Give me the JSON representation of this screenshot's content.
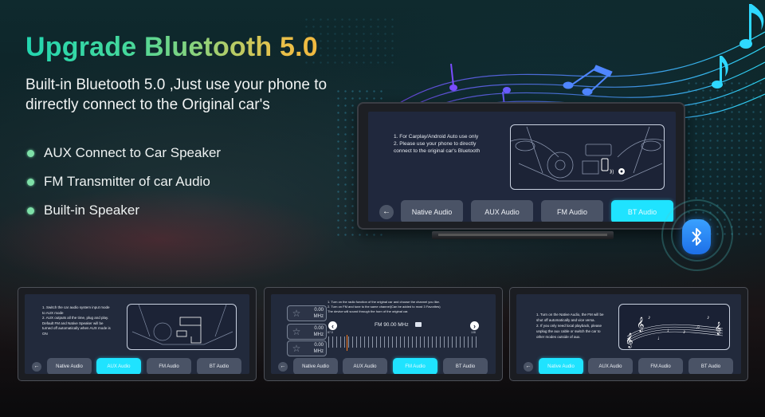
{
  "headline": "Upgrade Bluetooth 5.0",
  "subtitle": "Built-in Bluetooth 5.0 ,Just use your phone to dirrectly connect to the Original car's",
  "features": [
    "AUX Connect to Car Speaker",
    "FM Transmitter of car Audio",
    "Built-in Speaker"
  ],
  "colors": {
    "active_button": "#1fe3ff",
    "inactive_button": "#4a5366",
    "bullet": "#7ee0a8",
    "bluetooth_badge": "#2a86f5"
  },
  "main_device": {
    "instructions": [
      "1. For Carplay/Android Auto use only",
      "2. Please use your phone to directly",
      "connect to the original car's Bluetooth"
    ],
    "illustration": "car-interior-bluetooth",
    "back_icon": "←",
    "buttons": [
      "Native Audio",
      "AUX Audio",
      "FM Audio",
      "BT Audio"
    ],
    "active_button": "BT Audio"
  },
  "aux_device": {
    "instructions": [
      "1. Switch the car audio system input mode",
      "to AUX mode",
      "2. AUX outputs all the time, plug and play.",
      "Default FM and Native Speaker will be",
      "turned off automatically when AUX mode is",
      "ON"
    ],
    "illustration": "car-interior-aux-cable",
    "back_icon": "←",
    "buttons": [
      "Native Audio",
      "AUX Audio",
      "FM Audio",
      "BT Audio"
    ],
    "active_button": "AUX Audio"
  },
  "fm_device": {
    "instructions": [
      "1. Turn on the radio function of the original car and choose the channel you like.",
      "2. Turn on FM and tune to the same channel(Can be added to most 3 Favorites)",
      "The device will sound through the horn of the original car."
    ],
    "favorites": [
      {
        "value": "0.00",
        "unit": "MHz"
      },
      {
        "value": "0.00",
        "unit": "MHz"
      },
      {
        "value": "0.00",
        "unit": "MHz"
      }
    ],
    "frequency_label": "FM 90.00 MHz",
    "frequency_mhz": 90.0,
    "range_min": "87.5",
    "range_max": "108",
    "prev_icon": "‹",
    "next_icon": "›",
    "back_icon": "←",
    "buttons": [
      "Native Audio",
      "AUX Audio",
      "FM Audio",
      "BT Audio"
    ],
    "active_button": "FM Audio"
  },
  "native_device": {
    "instructions": [
      "1. Turn on the Native Audio, the FM will be",
      "shut off automatically and vice versa.",
      "2. If you only need local playback, please",
      "unplug the aux cable or switch the car to",
      "other modes outside of aux."
    ],
    "illustration": "music-staff-notes",
    "back_icon": "←",
    "buttons": [
      "Native Audio",
      "AUX Audio",
      "FM Audio",
      "BT Audio"
    ],
    "active_button": "Native Audio"
  }
}
